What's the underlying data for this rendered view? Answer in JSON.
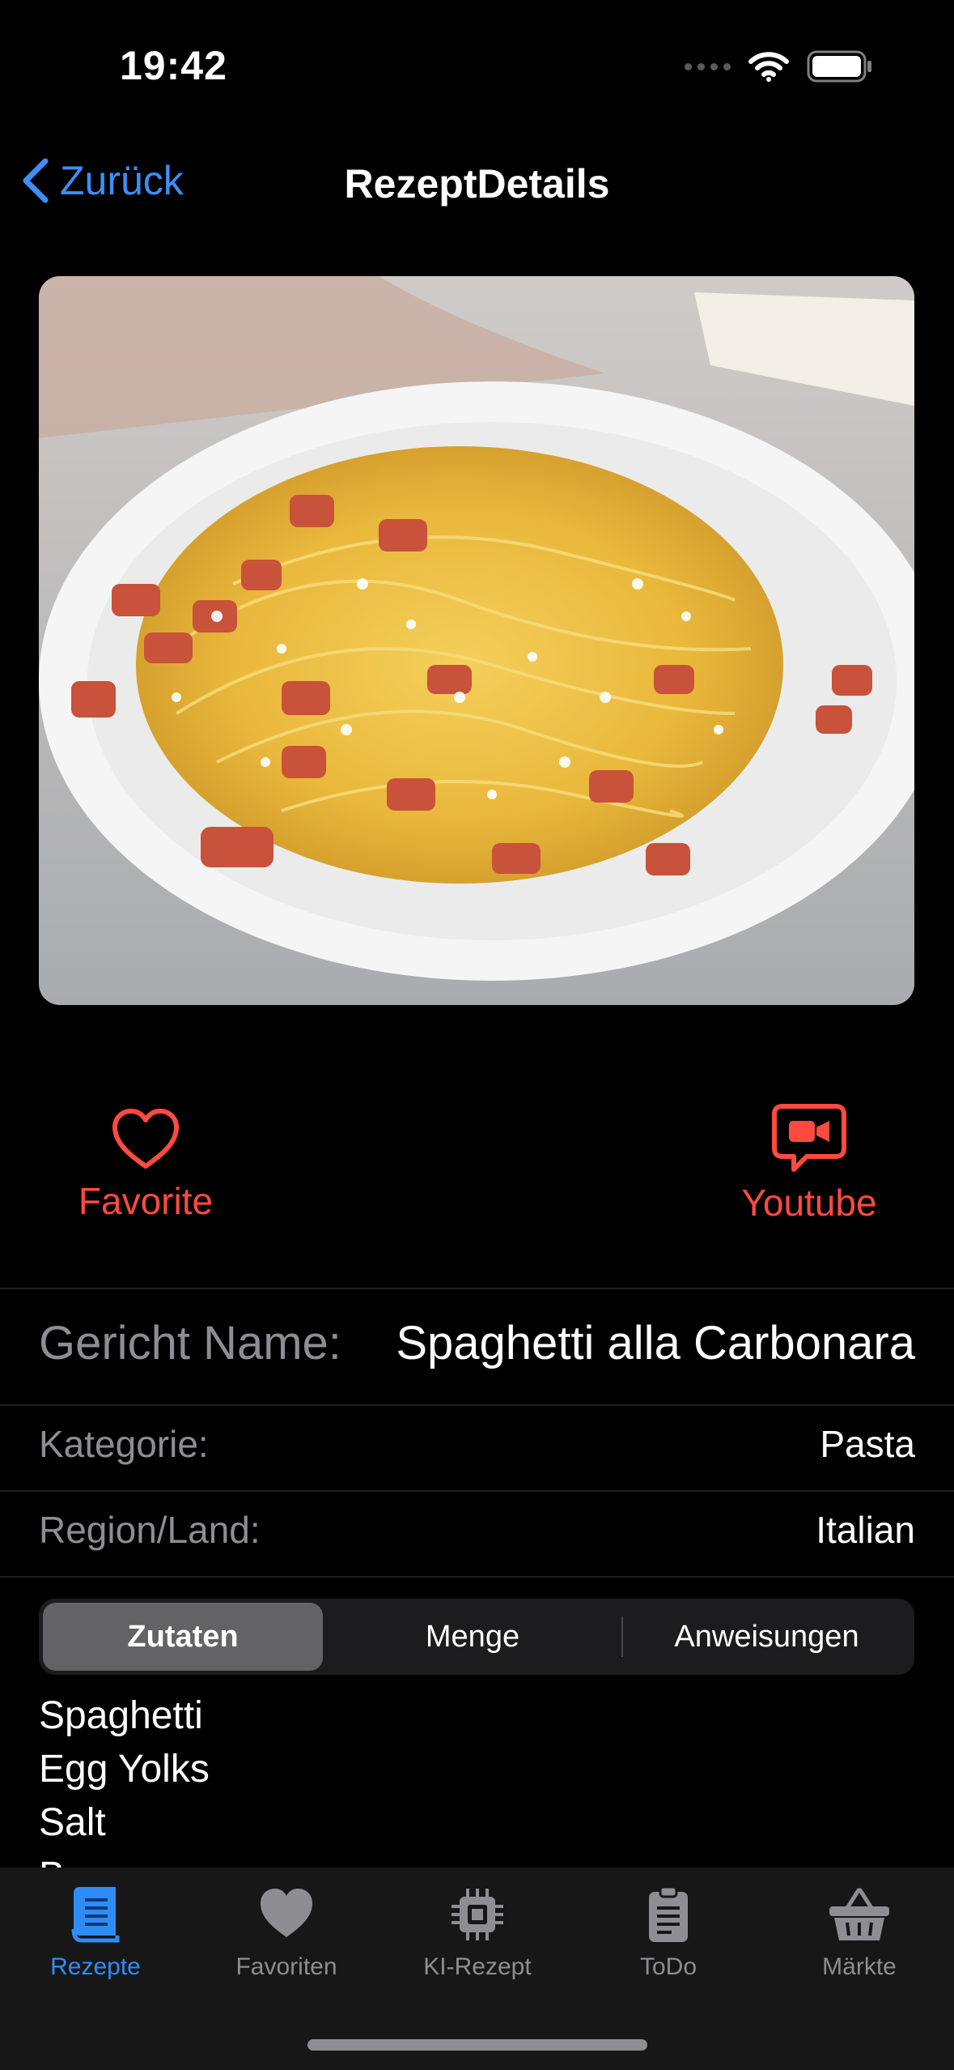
{
  "status_bar": {
    "time": "19:42"
  },
  "nav": {
    "back_label": "Zurück",
    "title": "RezeptDetails"
  },
  "actions": {
    "favorite_label": "Favorite",
    "youtube_label": "Youtube"
  },
  "details": {
    "dish_name_label": "Gericht Name:",
    "dish_name_value": "Spaghetti alla Carbonara",
    "category_label": "Kategorie:",
    "category_value": "Pasta",
    "region_label": "Region/Land:",
    "region_value": "Italian"
  },
  "segments": {
    "selected": "Zutaten",
    "items": [
      "Zutaten",
      "Menge",
      "Anweisungen"
    ]
  },
  "ingredients": [
    "Spaghetti",
    "Egg Yolks",
    "Salt",
    "Bacon"
  ],
  "tab_bar": {
    "items": [
      {
        "label": "Rezepte",
        "icon": "book-icon",
        "active": true
      },
      {
        "label": "Favoriten",
        "icon": "heart-icon",
        "active": false
      },
      {
        "label": "KI-Rezept",
        "icon": "chip-icon",
        "active": false
      },
      {
        "label": "ToDo",
        "icon": "clipboard-icon",
        "active": false
      },
      {
        "label": "Märkte",
        "icon": "basket-icon",
        "active": false
      }
    ]
  },
  "colors": {
    "accent": "#2f8cf6",
    "action": "#ff4a40",
    "background": "#000000",
    "secondary_text": "#8d8d92"
  }
}
